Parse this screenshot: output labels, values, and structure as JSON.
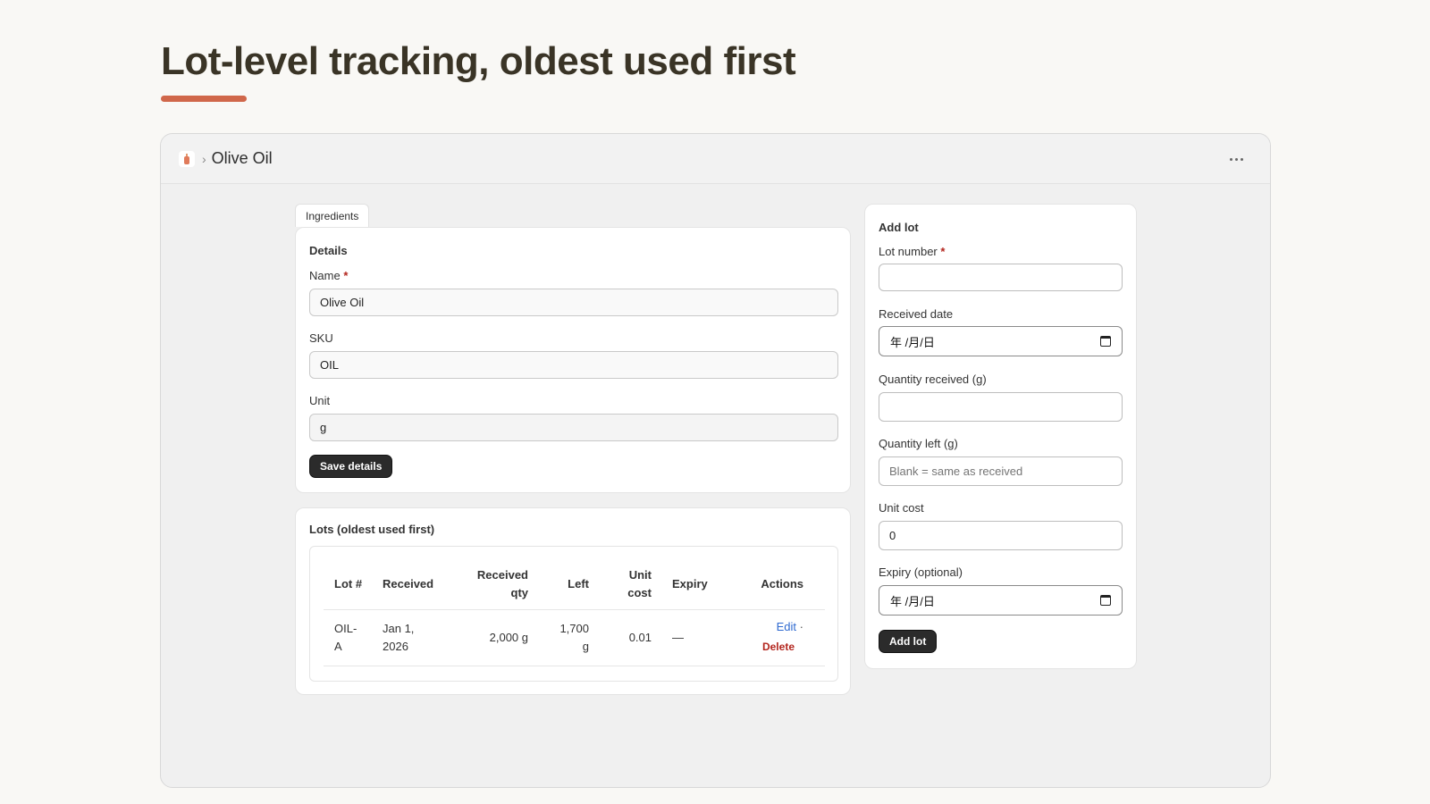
{
  "page": {
    "headline": "Lot-level tracking, oldest used first",
    "accent_color": "#d0674a"
  },
  "window": {
    "app_icon": "olive-oil-bottle-icon",
    "breadcrumb_separator": "›",
    "title": "Olive Oil",
    "more_icon": "more-horizontal-icon"
  },
  "tab": {
    "label": "Ingredients"
  },
  "details": {
    "title": "Details",
    "name_label": "Name",
    "name_value": "Olive Oil",
    "required_mark": "*",
    "sku_label": "SKU",
    "sku_value": "OIL",
    "unit_label": "Unit",
    "unit_value": "g",
    "save_label": "Save details"
  },
  "lots": {
    "title": "Lots (oldest used first)",
    "columns": {
      "lot": "Lot #",
      "received": "Received",
      "received_qty_line1": "Received",
      "received_qty_line2": "qty",
      "left": "Left",
      "unit_cost_line1": "Unit",
      "unit_cost_line2": "cost",
      "expiry": "Expiry",
      "actions": "Actions"
    },
    "rows": [
      {
        "lot_line1": "OIL-",
        "lot_line2": "A",
        "received_line1": "Jan 1,",
        "received_line2": "2026",
        "received_qty": "2,000 g",
        "left_line1": "1,700",
        "left_line2": "g",
        "unit_cost": "0.01",
        "expiry": "—",
        "edit_label": "Edit",
        "separator": "·",
        "delete_label": "Delete"
      }
    ]
  },
  "add_lot": {
    "title": "Add lot",
    "lot_number_label": "Lot number",
    "lot_number_value": "",
    "received_date_label": "Received date",
    "received_date_value": "年 /月/日",
    "qty_received_label": "Quantity received (g)",
    "qty_received_value": "",
    "qty_left_label": "Quantity left (g)",
    "qty_left_placeholder": "Blank = same as received",
    "unit_cost_label": "Unit cost",
    "unit_cost_value": "0",
    "expiry_label": "Expiry (optional)",
    "expiry_value": "年 /月/日",
    "calendar_icon": "calendar-icon",
    "submit_label": "Add lot"
  }
}
